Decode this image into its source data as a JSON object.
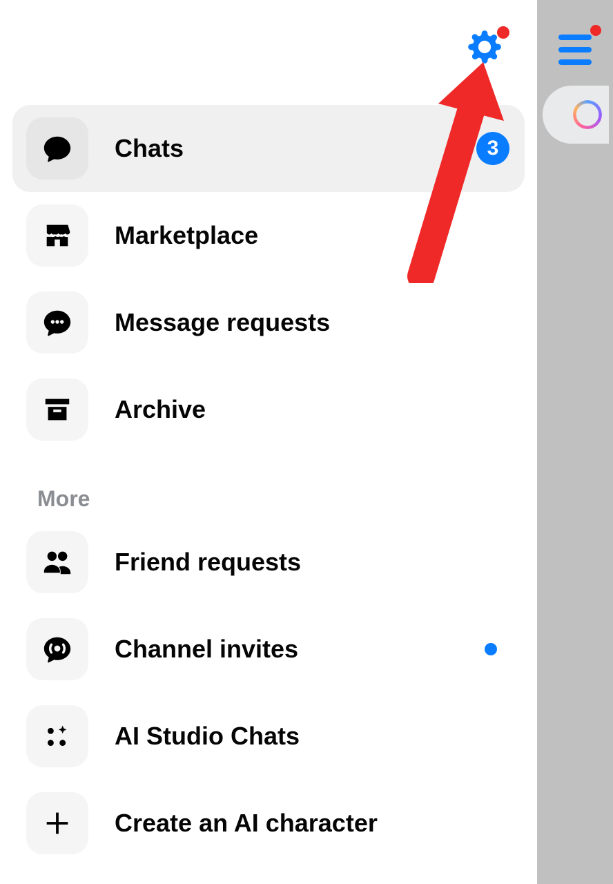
{
  "header": {
    "settings_has_notification": true
  },
  "nav": [
    {
      "key": "chats",
      "label": "Chats",
      "icon": "chat-icon",
      "active": true,
      "badge": "3"
    },
    {
      "key": "marketplace",
      "label": "Marketplace",
      "icon": "marketplace-icon",
      "active": false
    },
    {
      "key": "message-requests",
      "label": "Message requests",
      "icon": "message-requests-icon",
      "active": false
    },
    {
      "key": "archive",
      "label": "Archive",
      "icon": "archive-icon",
      "active": false
    }
  ],
  "more_section": {
    "label": "More",
    "items": [
      {
        "key": "friend-requests",
        "label": "Friend requests",
        "icon": "friends-icon",
        "active": false
      },
      {
        "key": "channel-invites",
        "label": "Channel invites",
        "icon": "channel-icon",
        "active": false,
        "dot": true
      },
      {
        "key": "ai-studio",
        "label": "AI Studio Chats",
        "icon": "ai-studio-icon",
        "active": false
      },
      {
        "key": "create-ai",
        "label": "Create an AI character",
        "icon": "plus-icon",
        "active": false
      }
    ]
  },
  "right_strip": {
    "menu_has_notification": true
  },
  "annotation": {
    "color": "#ef2828"
  }
}
